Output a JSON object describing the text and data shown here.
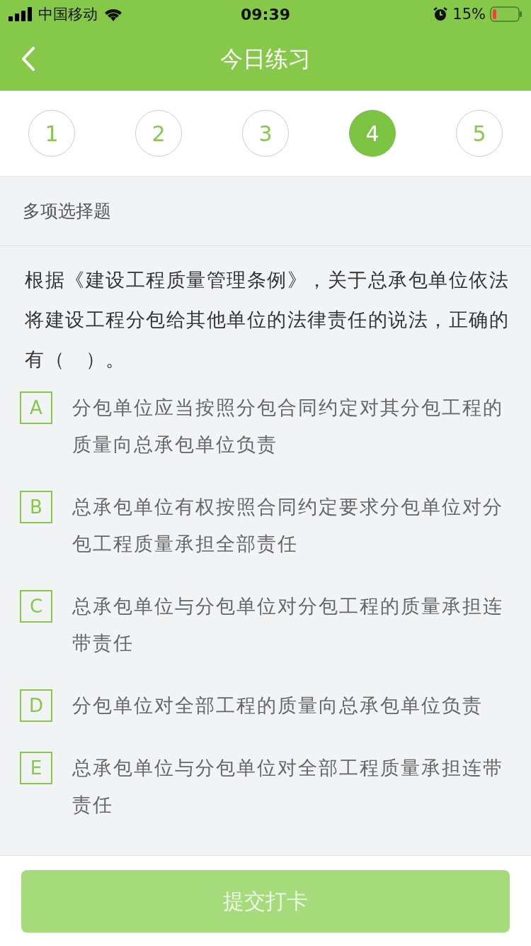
{
  "status_bar": {
    "carrier": "中国移动",
    "time": "09:39",
    "battery": "15%"
  },
  "nav": {
    "title": "今日练习"
  },
  "questions": [
    {
      "label": "1",
      "selected": false
    },
    {
      "label": "2",
      "selected": false
    },
    {
      "label": "3",
      "selected": false
    },
    {
      "label": "4",
      "selected": true
    },
    {
      "label": "5",
      "selected": false
    }
  ],
  "question_type": "多项选择题",
  "question": "根据《建设工程质量管理条例》，关于总承包单位依法将建设工程分包给其他单位的法律责任的说法，正确的有（　）。",
  "options": [
    {
      "letter": "A",
      "text": "分包单位应当按照分包合同约定对其分包工程的质量向总承包单位负责",
      "selected": false
    },
    {
      "letter": "B",
      "text": "总承包单位有权按照合同约定要求分包单位对分包工程质量承担全部责任",
      "selected": false
    },
    {
      "letter": "C",
      "text": "总承包单位与分包单位对分包工程的质量承担连带责任",
      "selected": false
    },
    {
      "letter": "D",
      "text": "分包单位对全部工程的质量向总承包单位负责",
      "selected": false
    },
    {
      "letter": "E",
      "text": "总承包单位与分包单位对全部工程质量承担连带责任",
      "selected": false
    }
  ],
  "submit": {
    "label": "提交打卡",
    "disabled": true
  }
}
